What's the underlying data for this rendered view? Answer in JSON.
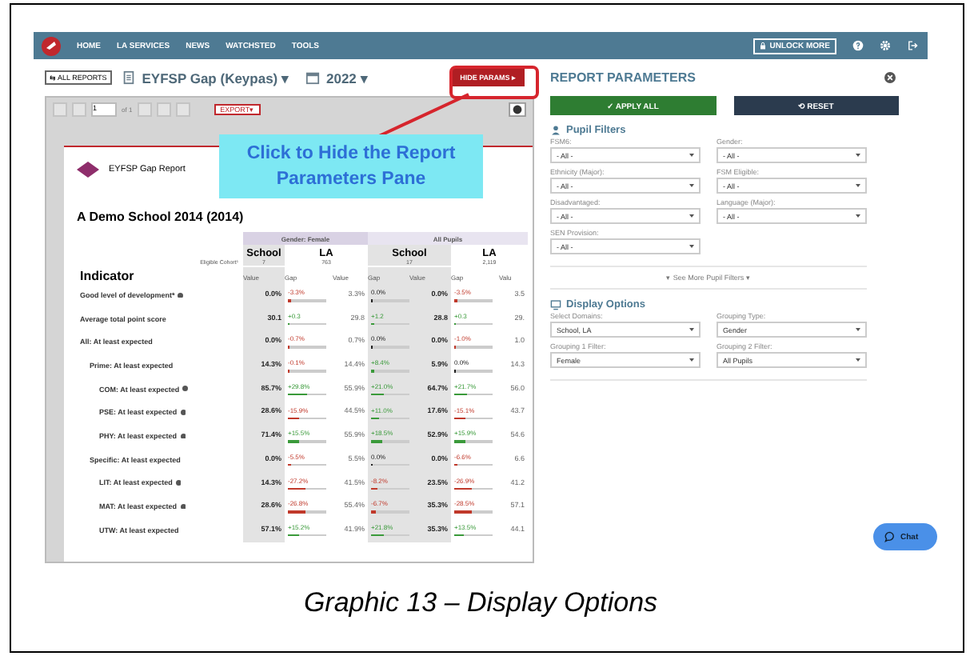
{
  "nav": {
    "items": [
      "HOME",
      "LA SERVICES",
      "NEWS",
      "WATCHSTED",
      "TOOLS"
    ],
    "unlock": "UNLOCK MORE"
  },
  "toolbar": {
    "all_reports": "⇆ ALL REPORTS",
    "report": "EYFSP Gap (Keypas) ▾",
    "year": "2022 ▾",
    "hide_params": "HIDE PARAMS ▸"
  },
  "viewer": {
    "page": "1",
    "of": "of 1",
    "export": "EXPORT▾"
  },
  "callout": "Click to Hide the Report Parameters Pane",
  "report": {
    "title": "EYFSP Gap Report",
    "school": "A Demo School 2014 (2014)",
    "groups": [
      "Gender: Female",
      "All Pupils"
    ],
    "domains": [
      "School",
      "LA",
      "School",
      "LA"
    ],
    "cohort_label": "Eligible Cohort¹",
    "cohorts": [
      "7",
      "763",
      "17",
      "2,119"
    ],
    "indicator_heading": "Indicator",
    "columns": [
      "Value",
      "Gap",
      "Value",
      "Gap",
      "Value",
      "Gap",
      "Valu"
    ],
    "rows": [
      {
        "label": "Good level of development*",
        "info": true,
        "values": [
          "0.0%",
          "3.3%",
          "0.0%",
          "3.5"
        ],
        "gaps": [
          {
            "text": "-3.3%",
            "level": 0.1,
            "color": "#c0392b"
          },
          {
            "text": "0.0%",
            "level": 0.03,
            "color": "#222222"
          },
          {
            "text": "-3.5%",
            "level": 0.1,
            "color": "#c0392b"
          }
        ]
      },
      {
        "label": "Average total point score",
        "info": false,
        "values": [
          "30.1",
          "29.8",
          "28.8",
          "29."
        ],
        "gaps": [
          {
            "text": "+0.3",
            "level": 0.05,
            "color": "#3a9a3a"
          },
          {
            "text": "+1.2",
            "level": 0.08,
            "color": "#3a9a3a"
          },
          {
            "text": "+0.3",
            "level": 0.05,
            "color": "#3a9a3a"
          }
        ]
      },
      {
        "label": "All: At least expected",
        "info": false,
        "values": [
          "0.0%",
          "0.7%",
          "0.0%",
          "1.0"
        ],
        "gaps": [
          {
            "text": "-0.7%",
            "level": 0.05,
            "color": "#c0392b"
          },
          {
            "text": "0.0%",
            "level": 0.03,
            "color": "#222222"
          },
          {
            "text": "-1.0%",
            "level": 0.05,
            "color": "#c0392b"
          }
        ],
        "children": [
          {
            "label": "Prime: At least expected",
            "info": false,
            "values": [
              "14.3%",
              "14.4%",
              "5.9%",
              "14.3"
            ],
            "gaps": [
              {
                "text": "-0.1%",
                "level": 0.03,
                "color": "#c0392b"
              },
              {
                "text": "+8.4%",
                "level": 0.08,
                "color": "#3a9a3a"
              },
              {
                "text": "0.0%",
                "level": 0.03,
                "color": "#222222"
              }
            ],
            "children": [
              {
                "label": "COM: At least expected",
                "info": true,
                "values": [
                  "85.7%",
                  "55.9%",
                  "64.7%",
                  "56.0"
                ],
                "gaps": [
                  {
                    "text": "+29.8%",
                    "level": 0.5,
                    "color": "#3a9a3a"
                  },
                  {
                    "text": "+21.0%",
                    "level": 0.35,
                    "color": "#3a9a3a"
                  },
                  {
                    "text": "+21.7%",
                    "level": 0.35,
                    "color": "#3a9a3a"
                  }
                ]
              },
              {
                "label": "PSE: At least expected",
                "info": true,
                "values": [
                  "28.6%",
                  "44.5%",
                  "17.6%",
                  "43.7"
                ],
                "gaps": [
                  {
                    "text": "-15.9%",
                    "level": 0.3,
                    "color": "#c0392b"
                  },
                  {
                    "text": "+11.0%",
                    "level": 0.2,
                    "color": "#3a9a3a"
                  },
                  {
                    "text": "-15.1%",
                    "level": 0.3,
                    "color": "#c0392b"
                  }
                ]
              },
              {
                "label": "PHY: At least expected",
                "info": true,
                "values": [
                  "71.4%",
                  "55.9%",
                  "52.9%",
                  "54.6"
                ],
                "gaps": [
                  {
                    "text": "+15.5%",
                    "level": 0.3,
                    "color": "#3a9a3a"
                  },
                  {
                    "text": "+18.5%",
                    "level": 0.3,
                    "color": "#3a9a3a"
                  },
                  {
                    "text": "+15.9%",
                    "level": 0.3,
                    "color": "#3a9a3a"
                  }
                ]
              }
            ]
          },
          {
            "label": "Specific: At least expected",
            "info": false,
            "values": [
              "0.0%",
              "5.5%",
              "0.0%",
              "6.6"
            ],
            "gaps": [
              {
                "text": "-5.5%",
                "level": 0.1,
                "color": "#c0392b"
              },
              {
                "text": "0.0%",
                "level": 0.03,
                "color": "#222222"
              },
              {
                "text": "-6.6%",
                "level": 0.1,
                "color": "#c0392b"
              }
            ],
            "children": [
              {
                "label": "LIT: At least expected",
                "info": true,
                "values": [
                  "14.3%",
                  "41.5%",
                  "23.5%",
                  "41.2"
                ],
                "gaps": [
                  {
                    "text": "-27.2%",
                    "level": 0.45,
                    "color": "#c0392b"
                  },
                  {
                    "text": "-8.2%",
                    "level": 0.18,
                    "color": "#c0392b"
                  },
                  {
                    "text": "-26.9%",
                    "level": 0.45,
                    "color": "#c0392b"
                  }
                ]
              },
              {
                "label": "MAT: At least expected",
                "info": true,
                "values": [
                  "28.6%",
                  "55.4%",
                  "35.3%",
                  "57.1"
                ],
                "gaps": [
                  {
                    "text": "-26.8%",
                    "level": 0.45,
                    "color": "#c0392b"
                  },
                  {
                    "text": "-6.7%",
                    "level": 0.12,
                    "color": "#c0392b"
                  },
                  {
                    "text": "-28.5%",
                    "level": 0.45,
                    "color": "#c0392b"
                  }
                ]
              },
              {
                "label": "UTW: At least expected",
                "info": false,
                "values": [
                  "57.1%",
                  "41.9%",
                  "35.3%",
                  "44.1"
                ],
                "gaps": [
                  {
                    "text": "+15.2%",
                    "level": 0.28,
                    "color": "#3a9a3a"
                  },
                  {
                    "text": "+21.8%",
                    "level": 0.35,
                    "color": "#3a9a3a"
                  },
                  {
                    "text": "+13.5%",
                    "level": 0.25,
                    "color": "#3a9a3a"
                  }
                ]
              }
            ]
          }
        ]
      }
    ]
  },
  "params": {
    "title": "REPORT PARAMETERS",
    "apply": "✓ APPLY ALL",
    "reset": "⟲ RESET",
    "pupil_filters": {
      "heading": "Pupil Filters",
      "fields": [
        {
          "label": "FSM6:",
          "value": "- All -"
        },
        {
          "label": "Gender:",
          "value": "- All -"
        },
        {
          "label": "Ethnicity (Major):",
          "value": "- All -"
        },
        {
          "label": "FSM Eligible:",
          "value": "- All -"
        },
        {
          "label": "Disadvantaged:",
          "value": "- All -"
        },
        {
          "label": "Language (Major):",
          "value": "- All -"
        },
        {
          "label": "SEN Provision:",
          "value": "- All -"
        }
      ]
    },
    "see_more": "▾ See More Pupil Filters ▾",
    "display_options": {
      "heading": "Display Options",
      "fields": [
        {
          "label": "Select Domains:",
          "value": "School, LA"
        },
        {
          "label": "Grouping Type:",
          "value": "Gender"
        },
        {
          "label": "Grouping 1 Filter:",
          "value": "Female"
        },
        {
          "label": "Grouping 2 Filter:",
          "value": "All Pupils"
        }
      ]
    }
  },
  "chat": "Chat",
  "caption": "Graphic 13 – Display Options"
}
